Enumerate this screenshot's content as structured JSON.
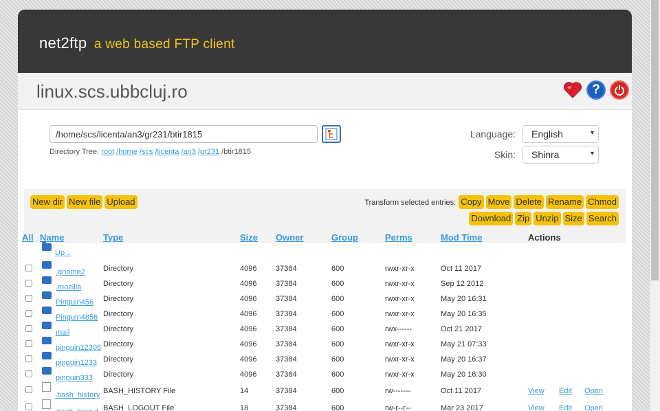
{
  "app": {
    "name": "net2ftp",
    "tagline": "a web based FTP client"
  },
  "host": "linux.scs.ubbcluj.ro",
  "icons": {
    "bookmark": "heart-icon",
    "help": "help-icon",
    "logout": "power-icon"
  },
  "path": {
    "value": "/home/scs/licenta/an3/gr231/btir1815"
  },
  "directory_tree": {
    "label": "Directory Tree:",
    "links": [
      "root",
      "/home",
      "/scs",
      "/licenta",
      "/an3",
      "/gr231"
    ],
    "current": "/btir1815"
  },
  "settings": {
    "language_label": "Language:",
    "language_value": "English",
    "skin_label": "Skin:",
    "skin_value": "Shinra"
  },
  "toolbar": {
    "left": [
      "New dir",
      "New file",
      "Upload"
    ],
    "transform_label": "Transform selected entries:",
    "row1": [
      "Copy",
      "Move",
      "Delete",
      "Rename",
      "Chmod"
    ],
    "row2": [
      "Download",
      "Zip",
      "Unzip",
      "Size",
      "Search"
    ]
  },
  "table": {
    "headers": {
      "all": "All",
      "name": "Name",
      "type": "Type",
      "size": "Size",
      "owner": "Owner",
      "group": "Group",
      "perms": "Perms",
      "mod": "Mod Time",
      "actions": "Actions"
    },
    "up_label": "Up ..",
    "rows": [
      {
        "name": ".gnome2",
        "type": "Directory",
        "size": "4096",
        "owner": "37384",
        "group": "600",
        "perms": "rwxr-xr-x",
        "mod": "Oct 11 2017",
        "kind": "dir"
      },
      {
        "name": ".mozilla",
        "type": "Directory",
        "size": "4096",
        "owner": "37384",
        "group": "600",
        "perms": "rwxr-xr-x",
        "mod": "Sep 12 2012",
        "kind": "dir"
      },
      {
        "name": "Pinguin456",
        "type": "Directory",
        "size": "4096",
        "owner": "37384",
        "group": "600",
        "perms": "rwxr-xr-x",
        "mod": "May 20 16:31",
        "kind": "dir"
      },
      {
        "name": "Pinguin4856",
        "type": "Directory",
        "size": "4096",
        "owner": "37384",
        "group": "600",
        "perms": "rwxr-xr-x",
        "mod": "May 20 16:35",
        "kind": "dir"
      },
      {
        "name": "mail",
        "type": "Directory",
        "size": "4096",
        "owner": "37384",
        "group": "600",
        "perms": "rwx------",
        "mod": "Oct 21 2017",
        "kind": "dir"
      },
      {
        "name": "pinguin12306",
        "type": "Directory",
        "size": "4096",
        "owner": "37384",
        "group": "600",
        "perms": "rwxr-xr-x",
        "mod": "May 21 07:33",
        "kind": "dir"
      },
      {
        "name": "pinguin1233",
        "type": "Directory",
        "size": "4096",
        "owner": "37384",
        "group": "600",
        "perms": "rwxr-xr-x",
        "mod": "May 20 16:37",
        "kind": "dir"
      },
      {
        "name": "pinguin333",
        "type": "Directory",
        "size": "4096",
        "owner": "37384",
        "group": "600",
        "perms": "rwxr-xr-x",
        "mod": "May 20 16:30",
        "kind": "dir"
      },
      {
        "name": ".bash_history",
        "type": "BASH_HISTORY File",
        "size": "14",
        "owner": "37384",
        "group": "600",
        "perms": "rw-------",
        "mod": "Oct 11 2017",
        "kind": "file",
        "actions": [
          "View",
          "Edit",
          "Open"
        ]
      },
      {
        "name": ".bash_logout",
        "type": "BASH_LOGOUT File",
        "size": "18",
        "owner": "37384",
        "group": "600",
        "perms": "rw-r--r--",
        "mod": "Mar 23 2017",
        "kind": "file",
        "actions": [
          "View",
          "Edit",
          "Open"
        ]
      }
    ]
  }
}
